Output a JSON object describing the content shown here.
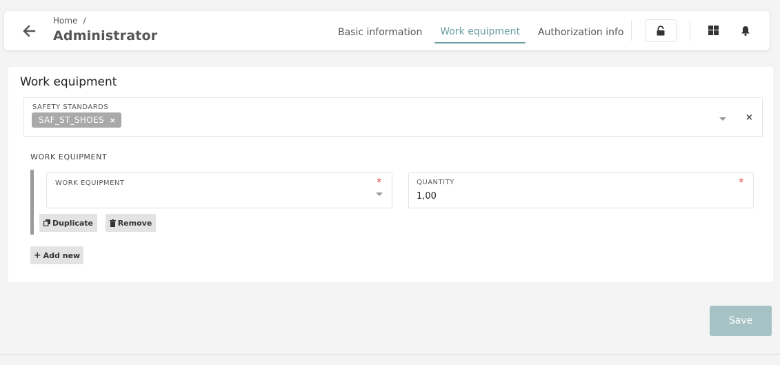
{
  "header": {
    "breadcrumb": {
      "home": "Home",
      "separator": "/"
    },
    "title": "Administrator",
    "tabs": [
      {
        "label": "Basic information",
        "active": false
      },
      {
        "label": "Work equipment",
        "active": true
      },
      {
        "label": "Authorization info",
        "active": false
      }
    ],
    "icons": [
      "arrow-left-icon",
      "unlock-icon",
      "grid-icon",
      "bell-icon"
    ]
  },
  "main": {
    "title": "Work equipment",
    "safety_standards": {
      "label": "SAFETY STANDARDS",
      "chips": [
        {
          "label": "SAF_ST_SHOES",
          "remove": "×"
        }
      ],
      "clear": "×"
    },
    "work_equipment_section": {
      "label": "WORK EQUIPMENT",
      "items": [
        {
          "equipment_label": "WORK EQUIPMENT",
          "equipment_value": "",
          "quantity_label": "QUANTITY",
          "quantity_value": "1,00",
          "required_mark": "*",
          "duplicate_label": "Duplicate",
          "remove_label": "Remove"
        }
      ],
      "add_new_label": "Add new"
    }
  },
  "footer": {
    "save_label": "Save"
  },
  "colors": {
    "accent": "#6a9ea3",
    "save_button": "#a5c3c4",
    "chip": "#a9a9a9",
    "required": "#e04545"
  }
}
